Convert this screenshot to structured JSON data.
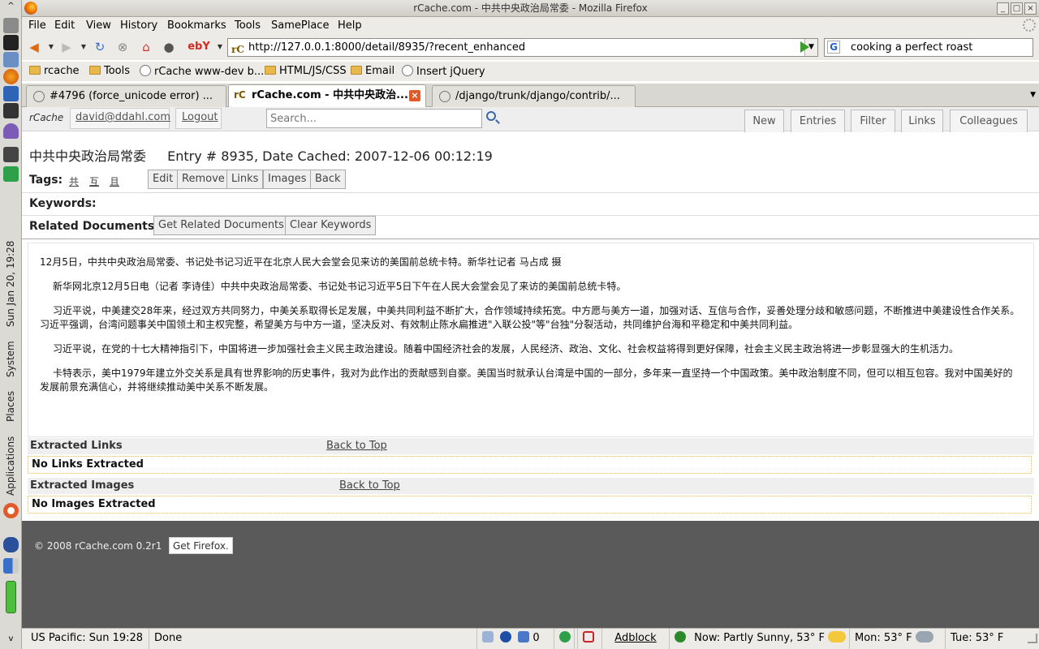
{
  "desktop": {
    "clock_vertical": "Sun Jan 20, 19:28",
    "menu_system": "System",
    "menu_places": "Places",
    "menu_applications": "Applications"
  },
  "window": {
    "title": "rCache.com - 中共中央政治局常委 - Mozilla Firefox"
  },
  "menubar": {
    "items": [
      "File",
      "Edit",
      "View",
      "History",
      "Bookmarks",
      "Tools",
      "SamePlace",
      "Help"
    ]
  },
  "navbar": {
    "url": "http://127.0.0.1:8000/detail/8935/?recent_enhanced",
    "search_value": "cooking a perfect roast",
    "ebay_label": "ebY"
  },
  "bookmarks": {
    "items": [
      "rcache",
      "Tools",
      "rCache www-dev b...",
      "HTML/JS/CSS",
      "Email",
      "Insert jQuery"
    ]
  },
  "tabs": [
    {
      "label": "#4796 (force_unicode error) ..."
    },
    {
      "label": "rCache.com - 中共中央政治..."
    },
    {
      "label": "/django/trunk/django/contrib/..."
    }
  ],
  "site": {
    "logo": "rCache",
    "user": "david@ddahl.com",
    "logout": "Logout",
    "search_placeholder": "Search...",
    "nav": [
      "New",
      "Entries",
      "Filter",
      "Links",
      "Colleagues"
    ]
  },
  "entry": {
    "title": "中共中央政治局常委",
    "meta": "Entry # 8935, Date Cached: 2007-12-06 00:12:19",
    "tags_label": "Tags:",
    "tags": [
      "共",
      "互",
      "且"
    ],
    "actions": [
      "Edit",
      "Remove",
      "Links",
      "Images",
      "Back"
    ],
    "keywords_label": "Keywords:",
    "related_label": "Related Documents:",
    "related_actions": [
      "Get Related Documents",
      "Clear Keywords"
    ],
    "paragraphs": [
      "12月5日，中共中央政治局常委、书记处书记习近平在北京人民大会堂会见来访的美国前总统卡特。新华社记者 马占成 摄",
      "新华网北京12月5日电（记者 李诗佳）中共中央政治局常委、书记处书记习近平5日下午在人民大会堂会见了来访的美国前总统卡特。",
      "习近平说，中美建交28年来，经过双方共同努力，中美关系取得长足发展，中美共同利益不断扩大，合作领域持续拓宽。中方愿与美方一道，加强对话、互信与合作，妥善处理分歧和敏感问题，不断推进中美建设性合作关系。习近平强调，台湾问题事关中国领土和主权完整，希望美方与中方一道，坚决反对、有效制止陈水扁推进\"入联公投\"等\"台独\"分裂活动，共同维护台海和平稳定和中美共同利益。",
      "习近平说，在党的十七大精神指引下，中国将进一步加强社会主义民主政治建设。随着中国经济社会的发展，人民经济、政治、文化、社会权益将得到更好保障，社会主义民主政治将进一步彰显强大的生机活力。",
      "卡特表示，美中1979年建立外交关系是具有世界影响的历史事件，我对为此作出的贡献感到自豪。美国当时就承认台湾是中国的一部分，多年来一直坚持一个中国政策。美中政治制度不同，但可以相互包容。我对中国美好的发展前景充满信心，并将继续推动美中关系不断发展。"
    ]
  },
  "extracted": {
    "links_title": "Extracted Links",
    "links_empty": "No Links Extracted",
    "images_title": "Extracted Images",
    "images_empty": "No Images Extracted",
    "back_to_top": "Back to Top"
  },
  "footer": {
    "copyright": "© 2008 rCache.com   0.2r1",
    "get_firefox": "Get Firefox."
  },
  "statusbar": {
    "clock": "US Pacific: Sun 19:28",
    "status": "Done",
    "mail_count": "0",
    "adblock": "Adblock",
    "weather_now": "Now: Partly Sunny, 53° F",
    "weather_mon": "Mon: 53° F",
    "weather_tue": "Tue: 53° F"
  }
}
